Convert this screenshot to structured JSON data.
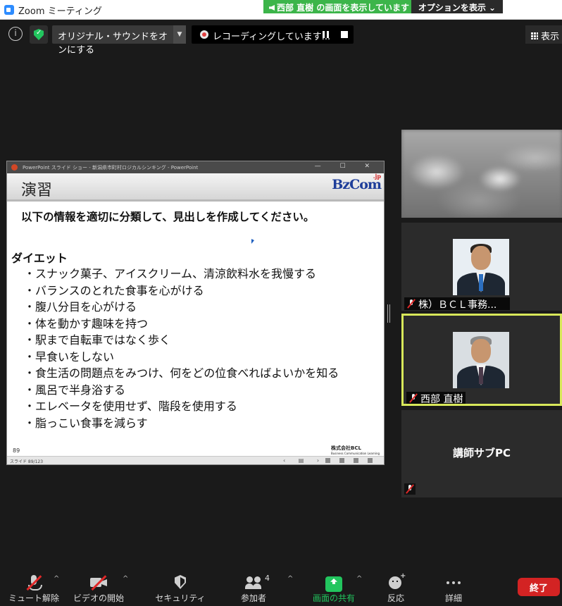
{
  "window": {
    "title": "Zoom ミーティング"
  },
  "banner": {
    "sharing_text": "西部 直樹 の画面を表示しています",
    "options_label": "オプションを表示 ⌄"
  },
  "topbar": {
    "original_sound_label": "オリジナル・サウンドをオンにする",
    "recording_label": "レコーディングしています...",
    "view_label": "表示"
  },
  "ppt": {
    "window_title": "PowerPoint スライド ショー  -  新潟県市町村ロジカルシンキング  -  PowerPoint",
    "window_controls": "—  ☐  ✕",
    "slide_title": "演習",
    "logo_text": "BzCom",
    "logo_suffix": ".jp",
    "instruction": "以下の情報を適切に分類して、見出しを作成してください。",
    "topic": "ダイエット",
    "items": [
      "・スナック菓子、アイスクリーム、清涼飲料水を我慢する",
      "・バランスのとれた食事を心がける",
      "・腹八分目を心がける",
      "・体を動かす趣味を持つ",
      "・駅まで自転車ではなく歩く",
      "・早食いをしない",
      "・食生活の問題点をみつけ、何をどの位食べればよいかを知る",
      "・風呂で半身浴する",
      "・エレベータを使用せず、階段を使用する",
      "・脂っこい食事を減らす"
    ],
    "slide_number": "89",
    "company_name": "株式会社BCL",
    "company_sub": "Business Communication Learning",
    "status_text": "スライド 89/123",
    "nav_symbols": "‹ ▤ ›"
  },
  "participants": [
    {
      "name": "株）ＢＣＬ事務...",
      "muted": true
    },
    {
      "name": "西部 直樹",
      "muted": true,
      "active_speaker": true
    },
    {
      "name": "講師サブPC",
      "muted": true
    }
  ],
  "toolbar": {
    "unmute_label": "ミュート解除",
    "video_label": "ビデオの開始",
    "security_label": "セキュリティ",
    "participants_label": "参加者",
    "participants_count": "4",
    "share_label": "画面の共有",
    "reactions_label": "反応",
    "more_label": "詳細",
    "end_label": "終了",
    "caret": "^"
  },
  "colors": {
    "share_green": "#22c55e",
    "end_red": "#d32323",
    "active_border": "#d8e85a",
    "logo_blue": "#1e3e9a"
  }
}
